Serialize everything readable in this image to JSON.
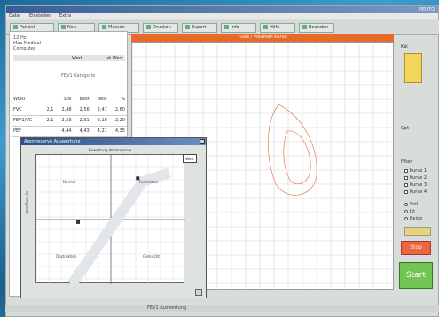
{
  "window": {
    "title": "",
    "brand": "PEDTO"
  },
  "menu": [
    "Datei",
    "Einstellen",
    "Extra"
  ],
  "toolbar": [
    {
      "label": "Patient"
    },
    {
      "label": "Neu"
    },
    {
      "label": "Messen"
    },
    {
      "label": "Drucken"
    },
    {
      "label": "Export"
    },
    {
      "label": "Info"
    },
    {
      "label": "Hilfe"
    },
    {
      "label": "Beenden"
    }
  ],
  "left_panel": {
    "line1": "12 Hz",
    "line2": "Max Medical",
    "line3": "Computer",
    "col_left": "Wert",
    "col_right": "Ist-Wert",
    "subtitle": "FEV1 Kategorie",
    "headers": [
      "WERT",
      "Soll",
      "Best",
      "Best",
      "%"
    ],
    "rows": [
      [
        "FVC",
        "2,1",
        "2,48",
        "2,56",
        "2,47",
        "2,60"
      ],
      [
        "FEV1/VC",
        "2,1",
        "2,33",
        "2,31",
        "2,18",
        "2,20"
      ],
      [
        "PEF",
        "",
        "4,44",
        "4,43",
        "4,21",
        "4,35"
      ]
    ]
  },
  "graph": {
    "header": "Fluss / Volumen Kurve"
  },
  "right_panel": {
    "icon": "thermometer-icon",
    "label_top": "Kal",
    "label_mid": "Opt",
    "label_filter": "Filter",
    "checks": [
      "Kurve 1",
      "Kurve 2",
      "Kurve 3",
      "Kurve 4"
    ],
    "radios": [
      "Soll",
      "Ist",
      "Beide"
    ]
  },
  "buttons": {
    "stop": "Stop",
    "start": "Start"
  },
  "popup": {
    "title": "Atemreserve Auswertung",
    "header": "Bewertung Atemreserve",
    "legend": "Wert",
    "quadrants": [
      "Normal",
      "Restriktion",
      "Obstruktion",
      "Gemischt"
    ],
    "yaxis": "Atemfluss l/s",
    "points": [
      {
        "x": 0.68,
        "y": 0.82
      },
      {
        "x": 0.28,
        "y": 0.48
      }
    ]
  },
  "status": {
    "text": "FEV1 Auswertung"
  },
  "colors": {
    "accent": "#e86a2b",
    "start": "#72c455",
    "stop": "#e9673a"
  }
}
